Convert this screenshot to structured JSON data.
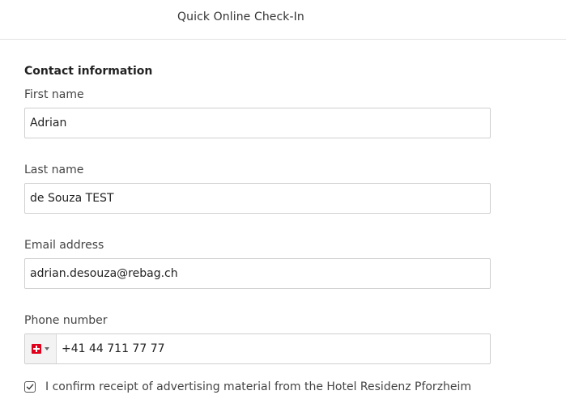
{
  "header": {
    "title": "Quick Online Check-In"
  },
  "form": {
    "section_title": "Contact information",
    "first_name": {
      "label": "First name",
      "value": "Adrian"
    },
    "last_name": {
      "label": "Last name",
      "value": "de Souza TEST"
    },
    "email": {
      "label": "Email address",
      "value": "adrian.desouza@rebag.ch"
    },
    "phone": {
      "label": "Phone number",
      "country_icon": "swiss-flag-icon",
      "value": "+41 44 711 77 77"
    },
    "consent": {
      "label": "I confirm receipt of advertising material from the Hotel Residenz Pforzheim",
      "checked": true
    }
  },
  "colors": {
    "flag_red": "#e1001b",
    "border": "#cfcfcf",
    "text": "#333333"
  }
}
